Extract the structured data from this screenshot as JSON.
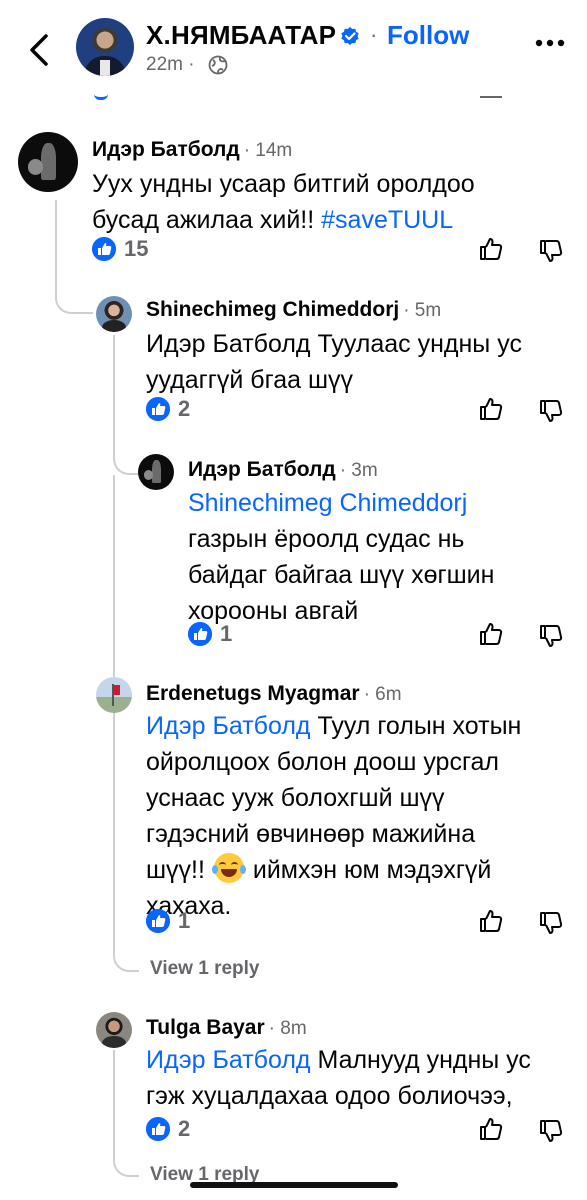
{
  "header": {
    "name": "Х.НЯМБААТАР",
    "separator": "·",
    "follow_label": "Follow",
    "time": "22m ·",
    "verified_color": "#0866ff"
  },
  "comments": [
    {
      "author": "Идэр Батболд",
      "time": "· 14m",
      "lines": [
        "Уух ундны усаар битгий оролдоо",
        "бусад ажилаа хий!! "
      ],
      "hashtag": "#saveTUUL",
      "likes": "15"
    },
    {
      "author": "Shinechimeg Chimeddorj",
      "time": "· 5m",
      "lines": [
        "Идэр Батболд Туулаас ундны ус",
        "уудаггүй бгаа шүү"
      ],
      "likes": "2"
    },
    {
      "author": "Идэр Батболд",
      "time": "· 3m",
      "mention": "Shinechimeg Chimeddorj",
      "lines": [
        "газрын ёроолд судас нь",
        "байдаг байгаа шүү хөгшин",
        "хорооны авгай"
      ],
      "likes": "1"
    },
    {
      "author": "Erdenetugs Myagmar",
      "time": "· 6m",
      "mention": "Идэр Батболд",
      "line1_rest": " Туул голын хотын",
      "lines": [
        "ойролцоох болон доош урсгал",
        "уснаас ууж болохгшй шүү",
        "гэдэсний өвчинөөр мажийна"
      ],
      "line5_start": "шүү!! ",
      "line5_end": " иймхэн юм мэдэхгүй",
      "line6": "хахаха.",
      "likes": "1",
      "view_reply": "View 1 reply"
    },
    {
      "author": "Tulga Bayar",
      "time": "· 8m",
      "mention": "Идэр Батболд",
      "line1_rest": " Малнууд ундны ус",
      "lines": [
        "гэж хуцалдахаа одоо болиочээ,"
      ],
      "likes": "2",
      "view_reply": "View 1 reply"
    }
  ],
  "icons": {
    "back": "chevron-left-icon",
    "verified": "verified-badge-icon",
    "more": "more-horizontal-icon",
    "globe": "globe-icon",
    "like": "thumbs-up-icon",
    "dislike": "thumbs-down-icon",
    "emoji": "tears-of-joy-emoji"
  }
}
